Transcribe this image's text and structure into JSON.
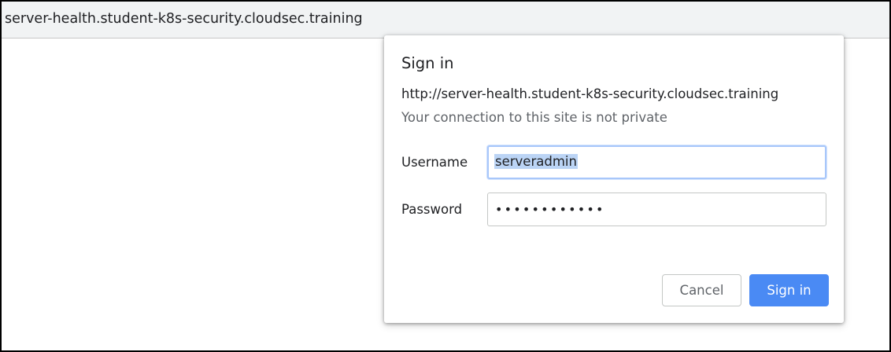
{
  "browser": {
    "address": "server-health.student-k8s-security.cloudsec.training"
  },
  "dialog": {
    "title": "Sign in",
    "url": "http://server-health.student-k8s-security.cloudsec.training",
    "warning": "Your connection to this site is not private",
    "username_label": "Username",
    "username_value": "serveradmin",
    "password_label": "Password",
    "password_mask": "••••••••••••",
    "cancel_label": "Cancel",
    "signin_label": "Sign in"
  },
  "colors": {
    "primary_button": "#4a8af4",
    "focus_ring": "#a8c7fa",
    "selection_highlight": "#bbd4f5"
  }
}
